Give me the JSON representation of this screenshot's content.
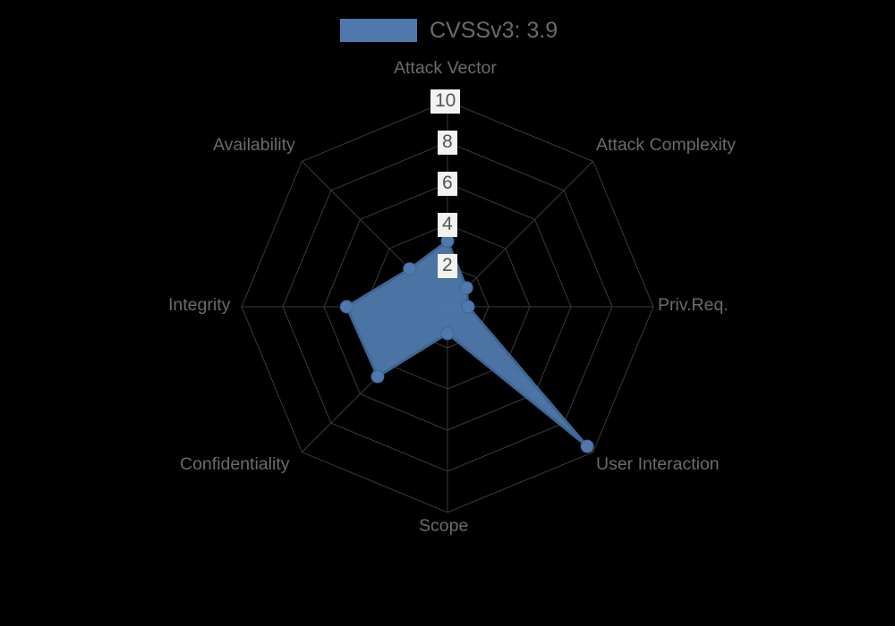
{
  "legend": {
    "swatch_color": "#4f79ac",
    "label": "CVSSv3: 3.9"
  },
  "colors": {
    "fill": "#4f79ac",
    "stroke": "#3f6692",
    "grid": "#3a3a3a",
    "label_text": "#6b6b6b",
    "tick_text": "#555555",
    "tick_bg": "#f2f2f2",
    "background": "#000000"
  },
  "axis_labels": {
    "attack_vector": "Attack Vector",
    "attack_complexity": "Attack Complexity",
    "priv_req": "Priv.Req.",
    "user_interaction": "User Interaction",
    "scope": "Scope",
    "confidentiality": "Confidentiality",
    "integrity": "Integrity",
    "availability": "Availability"
  },
  "ticks": {
    "t10": "10",
    "t8": "8",
    "t6": "6",
    "t4": "4",
    "t2": "2"
  },
  "chart_data": {
    "type": "radar",
    "title": "",
    "subtitle": "",
    "xlabel": "",
    "ylabel": "",
    "grid": true,
    "legend_position": "top",
    "rlim": [
      0,
      10
    ],
    "rticks": [
      2,
      4,
      6,
      8,
      10
    ],
    "categories": [
      "Attack Vector",
      "Attack Complexity",
      "Priv.Req.",
      "User Interaction",
      "Scope",
      "Confidentiality",
      "Integrity",
      "Availability"
    ],
    "series": [
      {
        "name": "CVSSv3: 3.9",
        "color": "#4f79ac",
        "values": [
          3.2,
          1.3,
          1.0,
          9.6,
          1.3,
          4.8,
          4.9,
          2.6
        ]
      }
    ]
  }
}
